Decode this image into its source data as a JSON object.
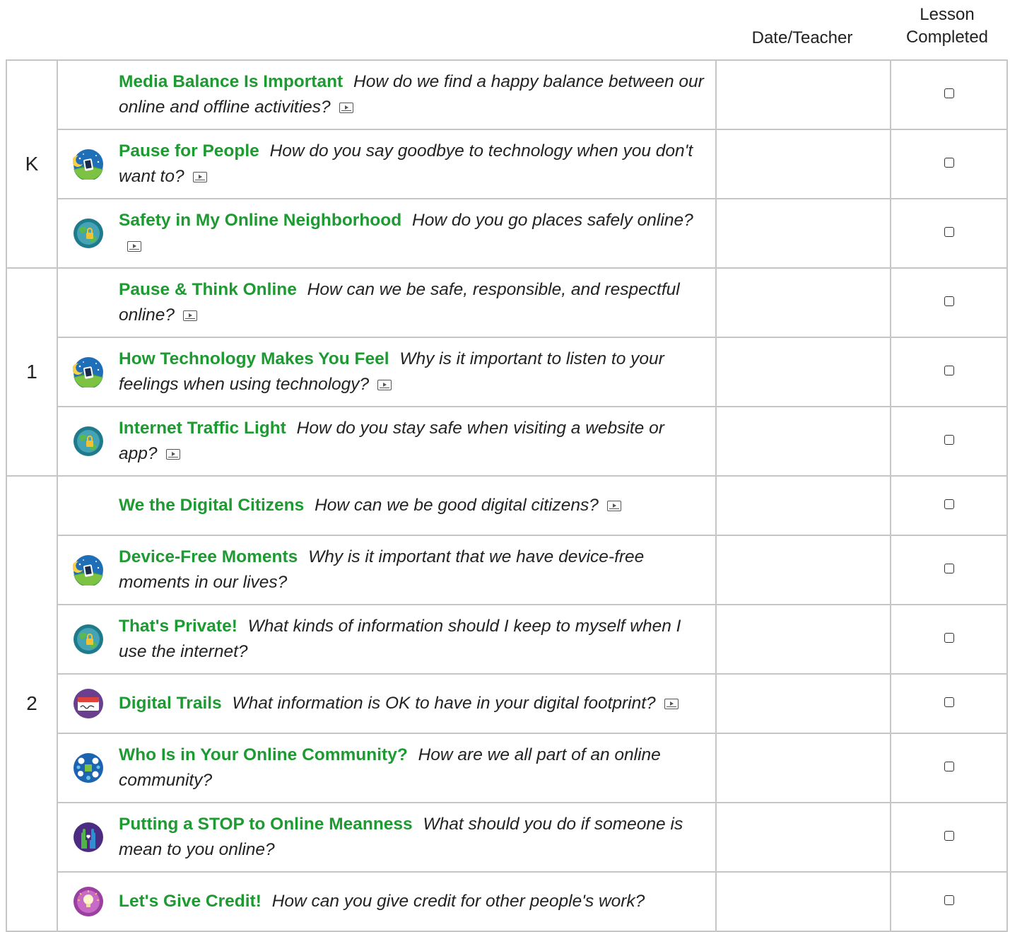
{
  "header": {
    "date_teacher": "Date/Teacher",
    "lesson_completed": "Lesson\nCompleted"
  },
  "grades": [
    {
      "label": "K",
      "lessons": [
        {
          "title": "Media Balance Is Important",
          "question": "How do we find a happy balance between our online and offline activities?",
          "icon": "",
          "video": true
        },
        {
          "title": "Pause for People",
          "question": "How do you say goodbye to technology when you don't want to?",
          "icon": "media-balance-icon",
          "video": true
        },
        {
          "title": "Safety in My Online Neighborhood",
          "question": "How do you go places safely online?",
          "icon": "privacy-security-icon",
          "video": true
        }
      ]
    },
    {
      "label": "1",
      "lessons": [
        {
          "title": "Pause & Think Online",
          "question": "How can we be safe, responsible, and respectful online?",
          "icon": "",
          "video": true
        },
        {
          "title": "How Technology Makes You Feel",
          "question": "Why is it important to listen to your feelings when using technology?",
          "icon": "media-balance-icon",
          "video": true
        },
        {
          "title": "Internet Traffic Light",
          "question": "How do you stay safe when visiting a website or app?",
          "icon": "privacy-security-icon",
          "video": true
        }
      ]
    },
    {
      "label": "2",
      "lessons": [
        {
          "title": "We the Digital Citizens",
          "question": "How can we be good digital citizens?",
          "icon": "",
          "video": true
        },
        {
          "title": "Device-Free Moments",
          "question": "Why is it important that we have device-free moments in our lives?",
          "icon": "media-balance-icon",
          "video": false
        },
        {
          "title": "That's Private!",
          "question": "What kinds of information should I keep to myself when I use the internet?",
          "icon": "privacy-security-icon",
          "video": false
        },
        {
          "title": "Digital Trails",
          "question": "What information is OK to have in your digital footprint?",
          "icon": "digital-footprint-icon",
          "video": true
        },
        {
          "title": "Who Is in Your Online Community?",
          "question": "How are we all part of an online community?",
          "icon": "relationships-communication-icon",
          "video": false
        },
        {
          "title": "Putting a STOP to Online Meanness",
          "question": "What should you do if someone is mean to you online?",
          "icon": "cyberbullying-icon",
          "video": false
        },
        {
          "title": "Let's Give Credit!",
          "question": "How can you give credit for other people's work?",
          "icon": "news-media-literacy-icon",
          "video": false
        }
      ]
    }
  ],
  "colors": {
    "title_green": "#1d9a31",
    "border": "#c6c6c6"
  }
}
